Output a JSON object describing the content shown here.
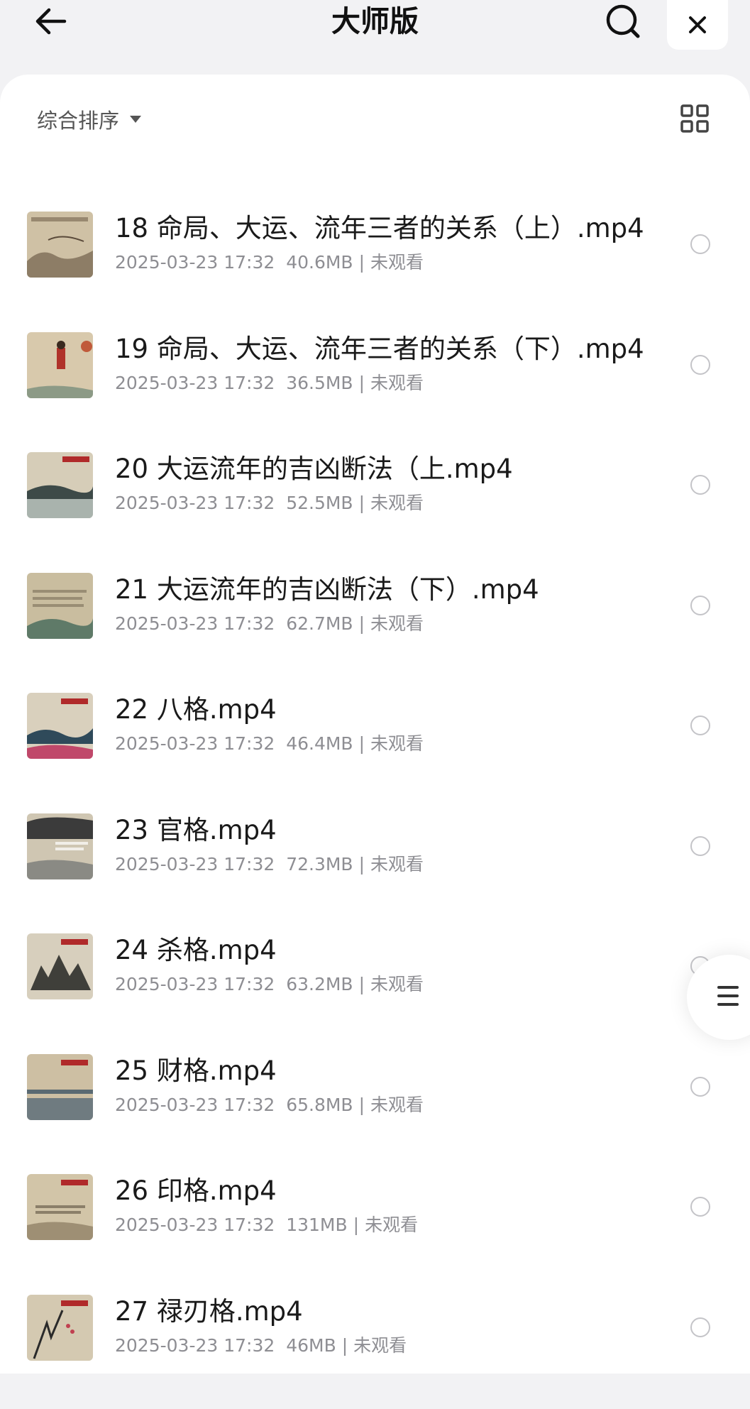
{
  "header": {
    "title": "大师版",
    "back_icon": "arrow-left-icon",
    "search_icon": "search-icon",
    "close_icon": "close-icon"
  },
  "toolbar": {
    "sort_label": "综合排序",
    "sort_icon": "caret-down-icon",
    "view_icon": "grid-view-icon"
  },
  "files": [
    {
      "name": "18 命局、大运、流年三者的关系（上）.mp4",
      "date": "2025-03-23 17:32",
      "size": "40.6MB",
      "status": "未观看",
      "selected": false
    },
    {
      "name": "19 命局、大运、流年三者的关系（下）.mp4",
      "date": "2025-03-23 17:32",
      "size": "36.5MB",
      "status": "未观看",
      "selected": false
    },
    {
      "name": "20 大运流年的吉凶断法（上.mp4",
      "date": "2025-03-23 17:32",
      "size": "52.5MB",
      "status": "未观看",
      "selected": false
    },
    {
      "name": "21 大运流年的吉凶断法（下）.mp4",
      "date": "2025-03-23 17:32",
      "size": "62.7MB",
      "status": "未观看",
      "selected": false
    },
    {
      "name": "22 八格.mp4",
      "date": "2025-03-23 17:32",
      "size": "46.4MB",
      "status": "未观看",
      "selected": false
    },
    {
      "name": "23 官格.mp4",
      "date": "2025-03-23 17:32",
      "size": "72.3MB",
      "status": "未观看",
      "selected": false
    },
    {
      "name": "24 杀格.mp4",
      "date": "2025-03-23 17:32",
      "size": "63.2MB",
      "status": "未观看",
      "selected": false
    },
    {
      "name": "25 财格.mp4",
      "date": "2025-03-23 17:32",
      "size": "65.8MB",
      "status": "未观看",
      "selected": false
    },
    {
      "name": "26 印格.mp4",
      "date": "2025-03-23 17:32",
      "size": "131MB",
      "status": "未观看",
      "selected": false
    },
    {
      "name": "27 禄刃格.mp4",
      "date": "2025-03-23 17:32",
      "size": "46MB",
      "status": "未观看",
      "selected": false
    }
  ],
  "floating_menu_icon": "menu-icon",
  "colors": {
    "background": "#f2f2f4",
    "panel": "#ffffff",
    "text_primary": "#1a1a1a",
    "text_secondary": "#8e8e93",
    "radio_border": "#c4c4c8"
  }
}
